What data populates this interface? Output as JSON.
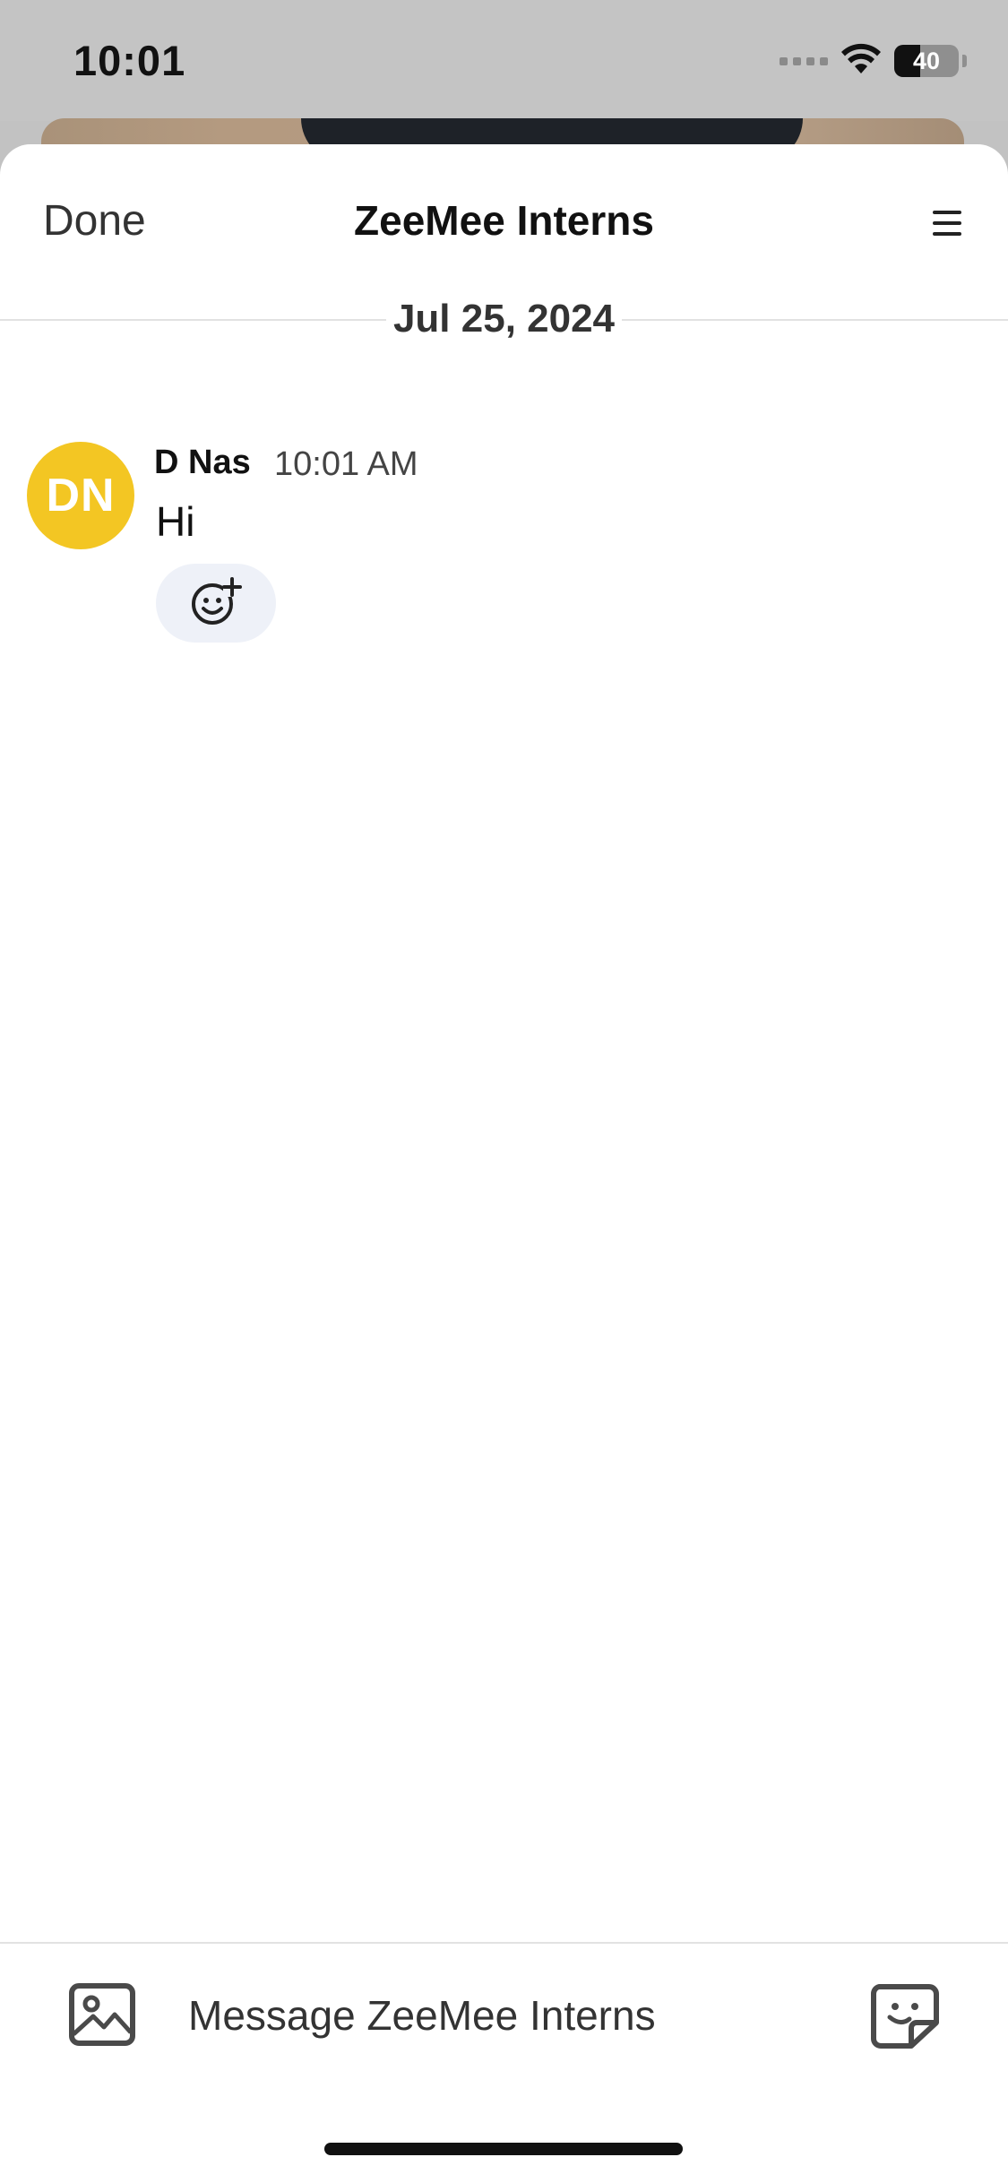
{
  "status_bar": {
    "time": "10:01",
    "battery": "40",
    "battery_level_percent": 40
  },
  "header": {
    "done_label": "Done",
    "title": "ZeeMee Interns",
    "menu_icon": "hamburger-menu-icon"
  },
  "chat": {
    "date_label": "Jul 25, 2024",
    "messages": [
      {
        "avatar_initials": "DN",
        "avatar_color": "#f3c623",
        "author": "D Nas",
        "time": "10:01 AM",
        "text": "Hi",
        "reaction_icon": "add-reaction-icon"
      }
    ]
  },
  "composer": {
    "image_icon": "image-icon",
    "placeholder": "Message ZeeMee Interns",
    "sticker_icon": "sticker-icon"
  },
  "colors": {
    "accent_avatar": "#f3c623",
    "reaction_bg": "#eef1f8",
    "divider": "#e2e2e2"
  }
}
